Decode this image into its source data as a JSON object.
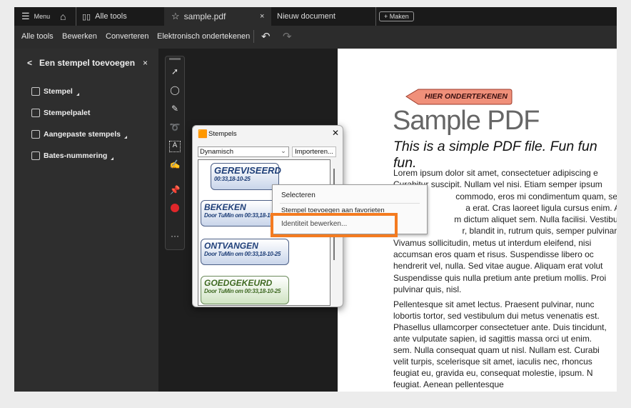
{
  "titlebar": {
    "menu": "Menu",
    "all_tools_tab": "Alle tools",
    "active_tab": "sample.pdf",
    "close": "×",
    "tab2": "Nieuw document",
    "create": "Maken"
  },
  "menubar": {
    "items": [
      "Alle tools",
      "Bewerken",
      "Converteren",
      "Elektronisch ondertekenen"
    ]
  },
  "sidebar": {
    "title": "Een stempel toevoegen",
    "close": "×",
    "items": [
      "Stempel",
      "Stempelpalet",
      "Aangepaste stempels",
      "Bates-nummering"
    ]
  },
  "dialog": {
    "title": "Stempels",
    "close": "✕",
    "category": "Dynamisch",
    "import": "Importeren...",
    "stamps": [
      {
        "name": "GEREVISEERD",
        "detail": "00:33,18-10-25"
      },
      {
        "name": "BEKEKEN",
        "detail": "Door TuMin om 00:33,18-10-25"
      },
      {
        "name": "ONTVANGEN",
        "detail": "Door TuMin om 00:33,18-10-25"
      },
      {
        "name": "GOEDGEKEURD",
        "detail": "Door TuMin om 00:33,18-10-25"
      }
    ]
  },
  "context_menu": {
    "items": [
      "Selecteren",
      "Stempel toevoegen aan favorieten",
      "Identiteit bewerken..."
    ],
    "highlight_color": "#f47b20"
  },
  "document": {
    "sign_here": "HIER ONDERTEKENEN",
    "title": "Sample PDF",
    "subtitle": "This is a simple PDF file. Fun fun fun.",
    "para1": [
      "Lorem ipsum dolor sit amet, consectetuer adipiscing e",
      "Curabitur suscipit. Nullam vel nisi. Etiam semper ipsum",
      "commodo, eros mi condimentum quam, sec",
      "a erat. Cras laoreet ligula cursus enim. Ae",
      "m dictum aliquet sem. Nulla facilisi. Vestibulu",
      "r, blandit in, rutrum quis, semper pulvinar, e",
      "Vivamus sollicitudin, metus ut interdum eleifend, nisi",
      "accumsan eros quam et risus. Suspendisse libero oc",
      "hendrerit vel, nulla. Sed vitae augue. Aliquam erat volut",
      "Suspendisse quis nulla pretium ante pretium mollis. Proi",
      "pulvinar quis, nisl."
    ],
    "para2": [
      "Pellentesque sit amet lectus. Praesent pulvinar, nunc",
      "lobortis tortor, sed vestibulum dui metus venenatis est.",
      "Phasellus ullamcorper consectetuer ante. Duis tincidunt,",
      "ante vulputate sapien, id sagittis massa orci ut enim.",
      "sem. Nulla consequat quam ut nisl. Nullam est. Curabi",
      "velit turpis, scelerisque sit amet, iaculis nec, rhoncus",
      "feugiat eu, gravida eu, consequat molestie, ipsum. N",
      "feugiat. Aenean pellentesque"
    ]
  }
}
